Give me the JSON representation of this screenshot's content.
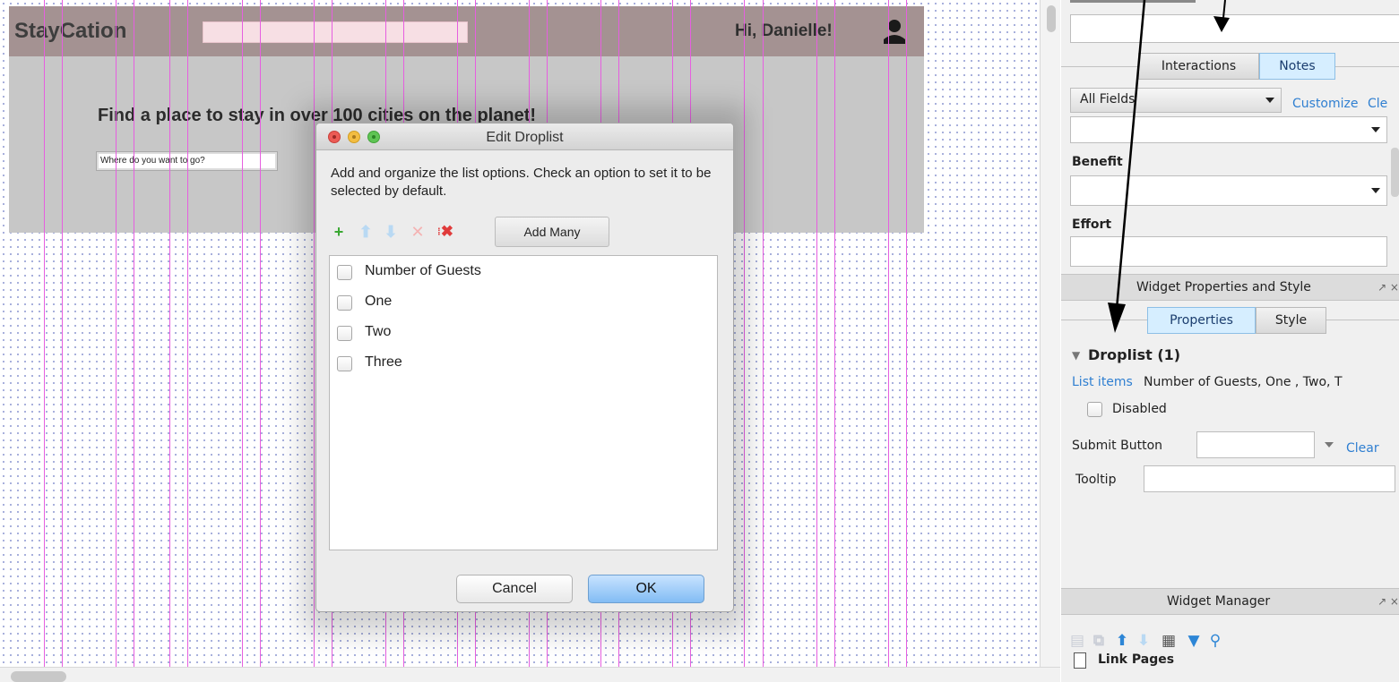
{
  "site": {
    "brand": "StayCation",
    "greeting": "Hi, Danielle!",
    "tagline": "Find a place to stay in over 100 cities on the planet!",
    "destination_placeholder": "Where do you want to go?"
  },
  "dialog": {
    "title": "Edit Droplist",
    "instructions": "Add and organize the list options. Check an option to set it to be selected by default.",
    "toolbar": {
      "add_icon": "plus-icon",
      "move_up_icon": "arrow-up-icon",
      "move_down_icon": "arrow-down-icon",
      "delete_icon": "delete-icon",
      "delete_all_icon": "delete-all-icon",
      "add_many_label": "Add Many"
    },
    "options": [
      "Number of Guests",
      "One",
      "Two",
      "Three"
    ],
    "cancel_label": "Cancel",
    "ok_label": "OK"
  },
  "panel": {
    "notes_tabs": [
      "Interactions",
      "Notes"
    ],
    "fields_filter": "All Fields",
    "customize_label": "Customize",
    "clear_partial": "Cle",
    "benefit_label": "Benefit",
    "effort_label": "Effort",
    "widget_props_title": "Widget Properties and Style",
    "props_tabs": [
      "Properties",
      "Style"
    ],
    "section_title": "Droplist (1)",
    "list_items_label": "List items",
    "list_items_value": "Number of Guests, One , Two, T",
    "disabled_label": "Disabled",
    "submit_button_label": "Submit Button",
    "clear_label": "Clear",
    "tooltip_label": "Tooltip",
    "widget_manager_title": "Widget Manager",
    "link_pages_label": "Link Pages",
    "panel_tools": "↗ ×"
  },
  "colors": {
    "header_bg": "#a49292",
    "hero_bg": "#c7c7c7",
    "guide_line": "#e65fe0",
    "ok_button": "#82bcf4",
    "link_blue": "#2f7fd1"
  }
}
